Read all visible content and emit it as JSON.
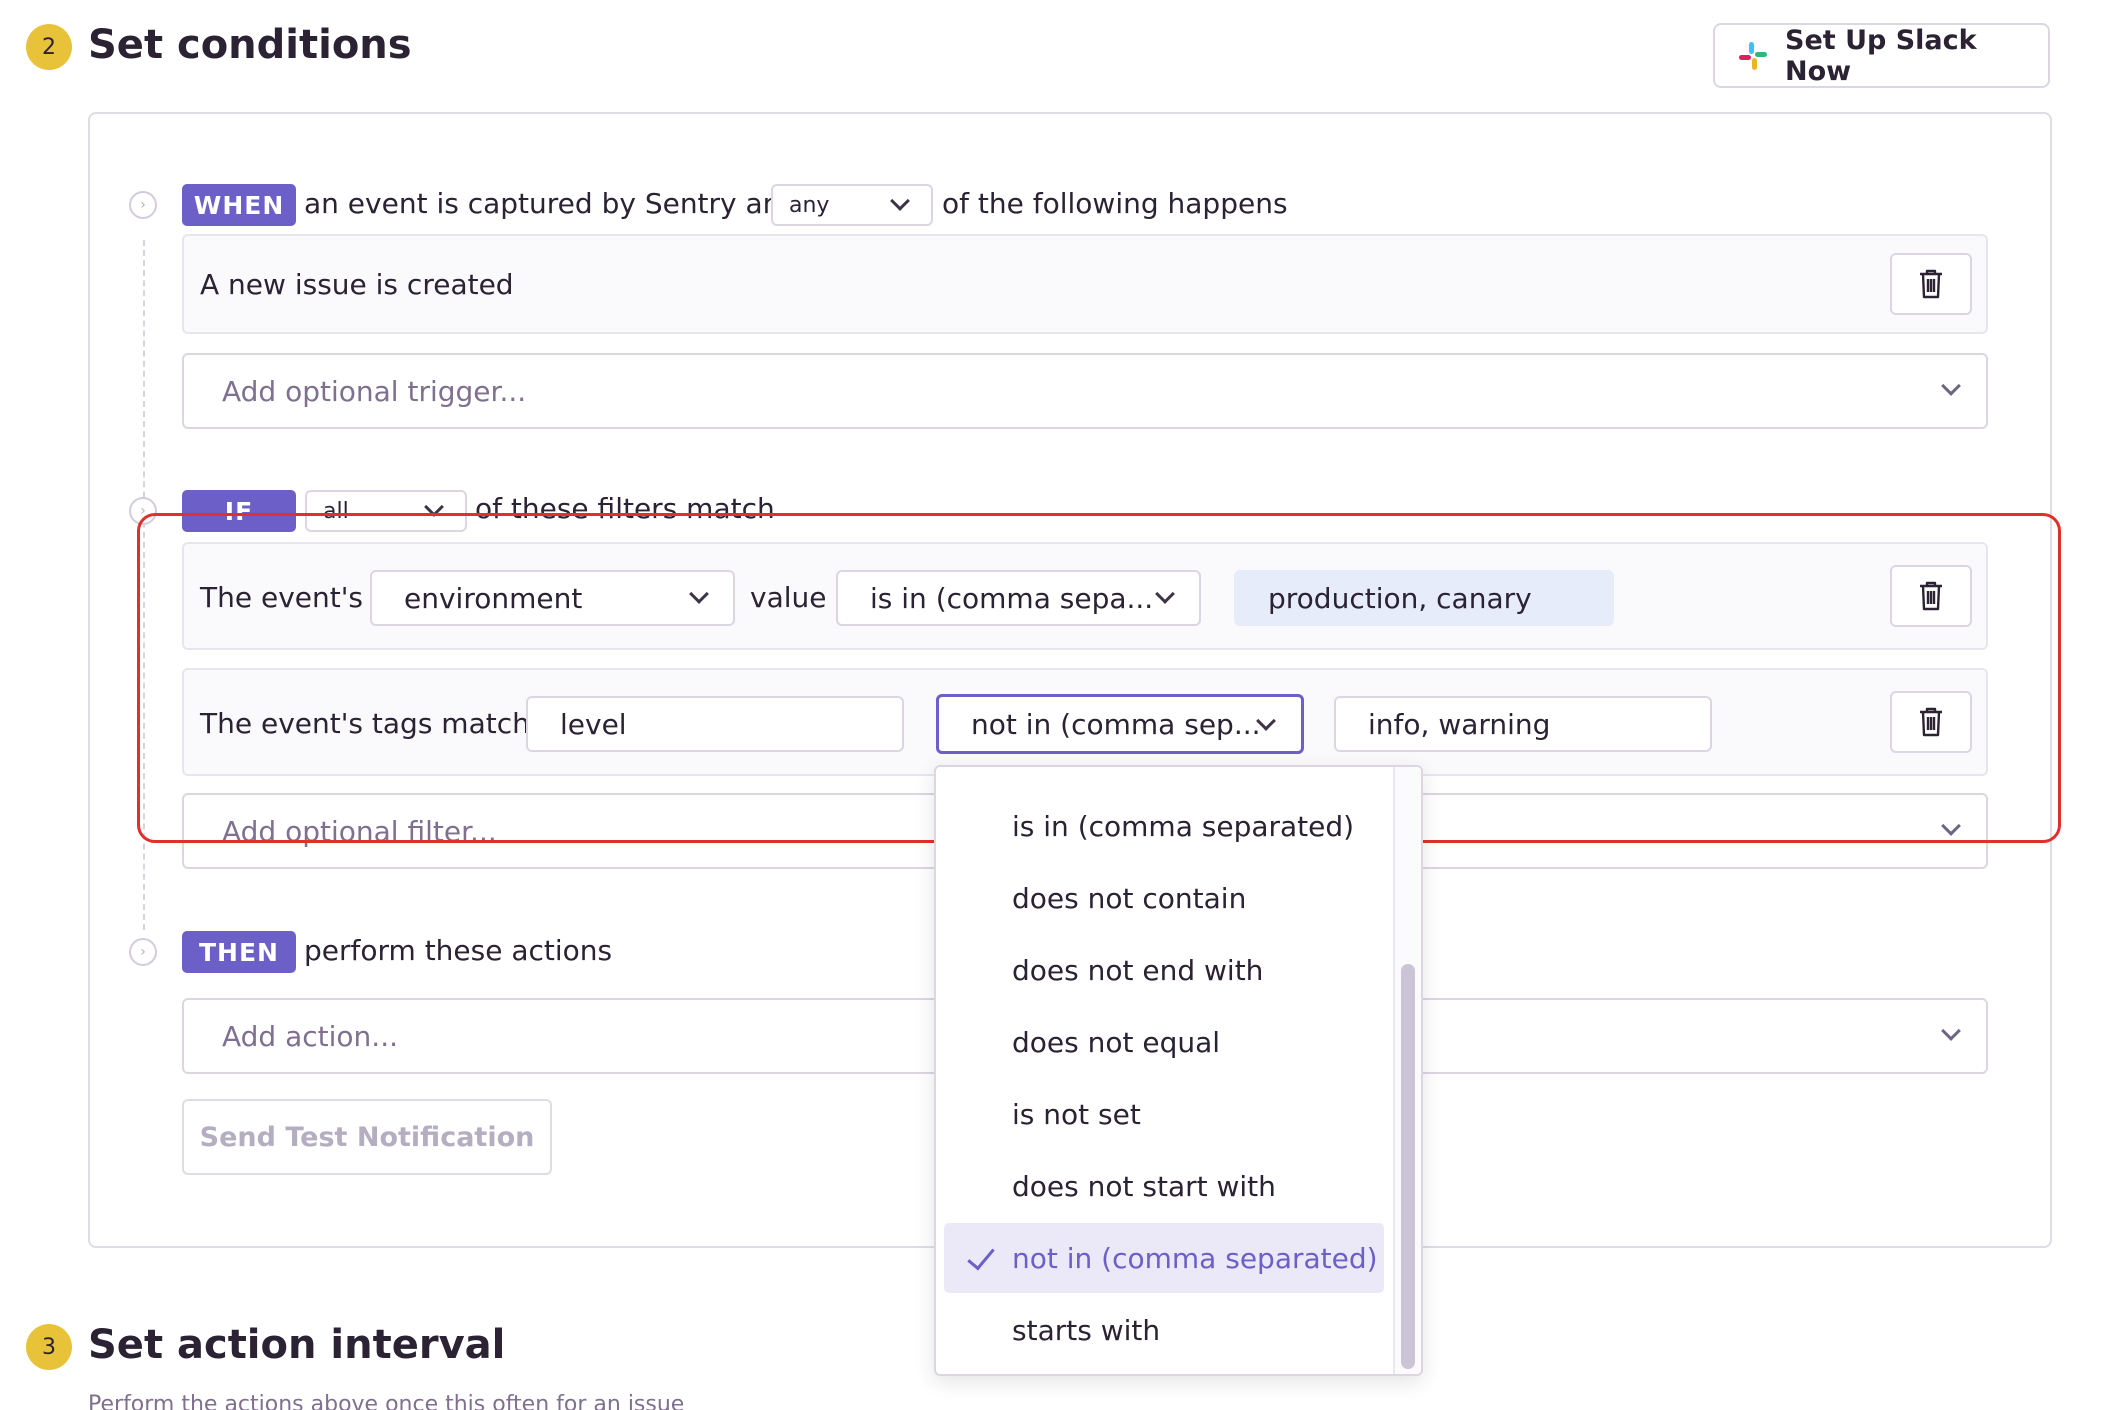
{
  "section2": {
    "number": "2",
    "title": "Set conditions"
  },
  "slack_button": {
    "label": "Set Up Slack Now"
  },
  "when": {
    "tag": "WHEN",
    "text_before": "an event is captured by Sentry and",
    "match_value": "any",
    "text_after": "of the following happens",
    "triggers": [
      "A new issue is created"
    ],
    "add_trigger_placeholder": "Add optional trigger..."
  },
  "if": {
    "tag": "IF",
    "match_value": "all",
    "text_after": "of these filters match",
    "filter1": {
      "label": "The event's",
      "attribute": "environment",
      "middle": "value",
      "operator": "is in (comma sepa...",
      "value": "production, canary"
    },
    "filter2": {
      "label": "The event's tags match",
      "key": "level",
      "operator": "not in (comma sep...",
      "value": "info, warning"
    },
    "add_filter_placeholder": "Add optional filter..."
  },
  "then": {
    "tag": "THEN",
    "text": "perform these actions",
    "add_action_placeholder": "Add action...",
    "test_button": "Send Test Notification"
  },
  "operator_dropdown": {
    "options": [
      "is in (comma separated)",
      "does not contain",
      "does not end with",
      "does not equal",
      "is not set",
      "does not start with",
      "not in (comma separated)",
      "starts with"
    ],
    "selected": "not in (comma separated)"
  },
  "section3": {
    "number": "3",
    "title": "Set action interval",
    "subtitle": "Perform the actions above once this often for an issue"
  },
  "colors": {
    "accent": "#6c5fc7",
    "step_badge": "#e8c33a",
    "annotation": "#e0302a"
  }
}
